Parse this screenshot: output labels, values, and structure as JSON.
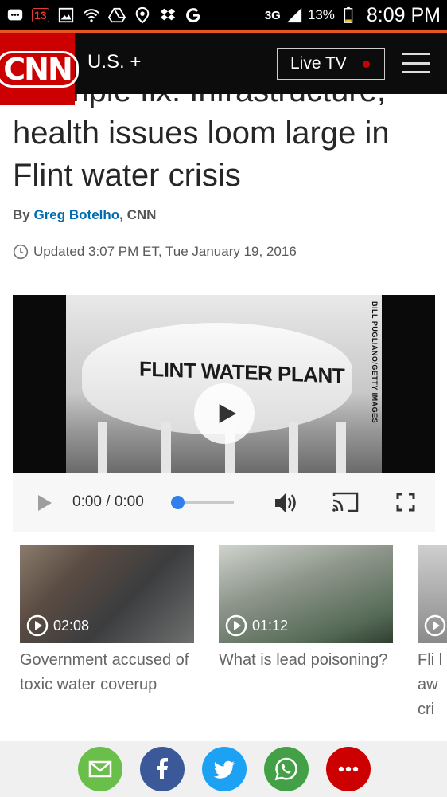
{
  "status_bar": {
    "notification_count": "13",
    "network": "3G",
    "battery": "13%",
    "time": "8:09 PM"
  },
  "header": {
    "logo": "CNN",
    "section": "U.S. +",
    "live_tv": "Live TV"
  },
  "article": {
    "headline_partial": "...simple fix: Infrastructure,",
    "headline_lines": [
      "health issues loom large in",
      "Flint water crisis"
    ],
    "byline_prefix": "By ",
    "author": "Greg Botelho",
    "byline_suffix": ", CNN",
    "updated": "Updated 3:07 PM ET, Tue January 19, 2016"
  },
  "video": {
    "overlay_text": "FLINT WATER PLANT",
    "credit": "BILL PUGLIANO/GETTY IMAGES",
    "time_display": "0:00 / 0:00",
    "progress": 0
  },
  "related": [
    {
      "duration": "02:08",
      "title": "Government accused of toxic water coverup"
    },
    {
      "duration": "01:12",
      "title": "What is lead poisoning?"
    },
    {
      "duration": "",
      "title": "Fli law cri"
    }
  ],
  "share": [
    {
      "name": "email",
      "color": "#6abf4b"
    },
    {
      "name": "facebook",
      "color": "#3b5998"
    },
    {
      "name": "twitter",
      "color": "#1da1f2"
    },
    {
      "name": "whatsapp",
      "color": "#43a047"
    },
    {
      "name": "more",
      "color": "#cc0000"
    }
  ]
}
